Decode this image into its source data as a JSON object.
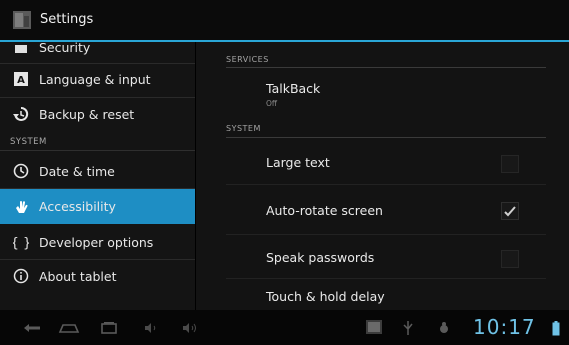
{
  "titlebar": {
    "title": "Settings",
    "icon": "settings-app-icon"
  },
  "sidebar": {
    "items": [
      {
        "label": "Security",
        "icon": "lock-icon"
      },
      {
        "label": "Language & input",
        "icon": "keyboard-a-icon"
      },
      {
        "label": "Backup & reset",
        "icon": "backup-icon"
      },
      {
        "label": "Date & time",
        "icon": "clock-icon"
      },
      {
        "label": "Accessibility",
        "icon": "hand-icon"
      },
      {
        "label": "Developer options",
        "icon": "braces-icon"
      },
      {
        "label": "About tablet",
        "icon": "info-icon"
      }
    ],
    "system_header": "SYSTEM",
    "selected": "Accessibility"
  },
  "content": {
    "services_header": "SERVICES",
    "system_header": "SYSTEM",
    "talkback": {
      "title": "TalkBack",
      "status": "Off"
    },
    "rows": [
      {
        "title": "Large text",
        "checked": false
      },
      {
        "title": "Auto-rotate screen",
        "checked": true
      },
      {
        "title": "Speak passwords",
        "checked": false
      },
      {
        "title": "Touch & hold delay",
        "checked": false
      }
    ]
  },
  "navbar": {
    "clock": "10:17",
    "icons": [
      "back-icon",
      "home-icon",
      "recent-apps-icon",
      "volume-down-icon",
      "volume-up-icon",
      "gallery-icon",
      "usb-icon",
      "debug-icon",
      "battery-icon"
    ]
  },
  "colors": {
    "accent": "#2aa6d6",
    "selected_bg": "#1e8ec4",
    "clock": "#6fc2e6"
  }
}
